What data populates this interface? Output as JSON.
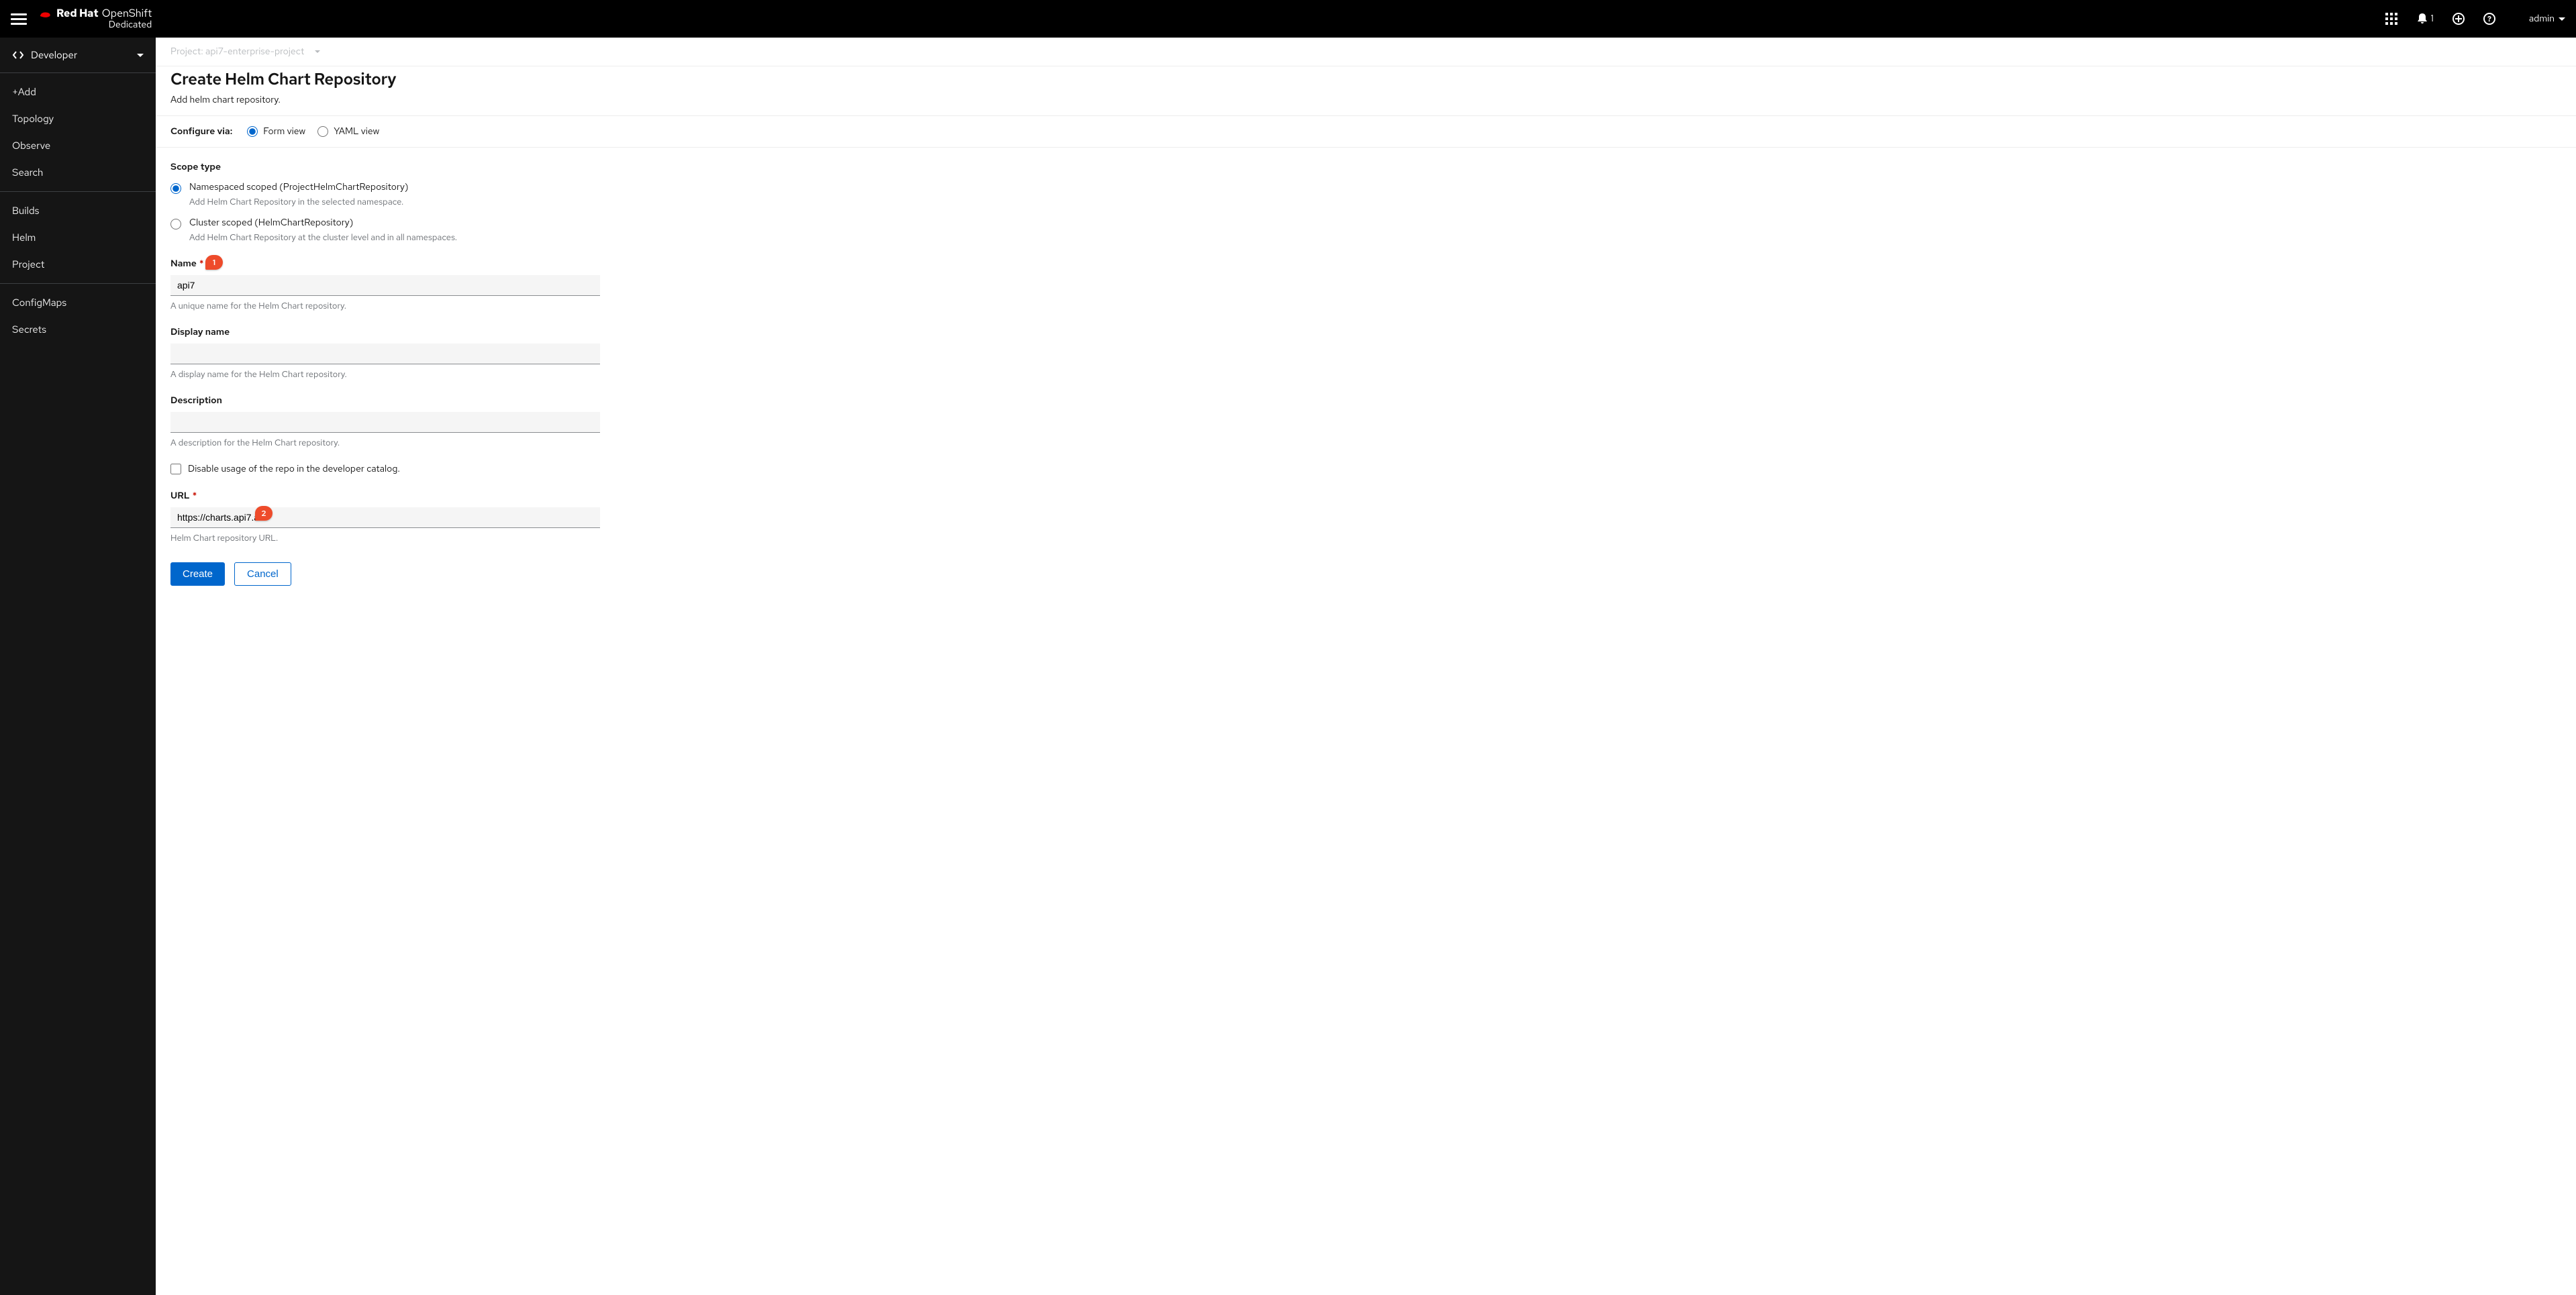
{
  "header": {
    "brand": "Red Hat",
    "product": "OpenShift",
    "subproduct": "Dedicated",
    "notification_count": "1",
    "user": "admin"
  },
  "sidebar": {
    "perspective": "Developer",
    "groups": [
      {
        "items": [
          "+Add",
          "Topology",
          "Observe",
          "Search"
        ]
      },
      {
        "items": [
          "Builds",
          "Helm",
          "Project"
        ]
      },
      {
        "items": [
          "ConfigMaps",
          "Secrets"
        ]
      }
    ]
  },
  "project_bar": {
    "label": "Project: api7-enterprise-project"
  },
  "page": {
    "title": "Create Helm Chart Repository",
    "subtitle": "Add helm chart repository."
  },
  "configure": {
    "label": "Configure via:",
    "options": [
      "Form view",
      "YAML view"
    ],
    "selected": "Form view"
  },
  "form": {
    "scope_label": "Scope type",
    "scope_options": [
      {
        "title": "Namespaced scoped (ProjectHelmChartRepository)",
        "desc": "Add Helm Chart Repository in the selected namespace."
      },
      {
        "title": "Cluster scoped (HelmChartRepository)",
        "desc": "Add Helm Chart Repository at the cluster level and in all namespaces."
      }
    ],
    "scope_selected": 0,
    "name_label": "Name",
    "name_value": "api7",
    "name_help": "A unique name for the Helm Chart repository.",
    "display_label": "Display name",
    "display_value": "",
    "display_help": "A display name for the Helm Chart repository.",
    "desc_label": "Description",
    "desc_value": "",
    "desc_help": "A description for the Helm Chart repository.",
    "disable_label": "Disable usage of the repo in the developer catalog.",
    "url_label": "URL",
    "url_value": "https://charts.api7.ai",
    "url_help": "Helm Chart repository URL.",
    "create_btn": "Create",
    "cancel_btn": "Cancel"
  },
  "annotations": {
    "a1": "1",
    "a2": "2"
  }
}
